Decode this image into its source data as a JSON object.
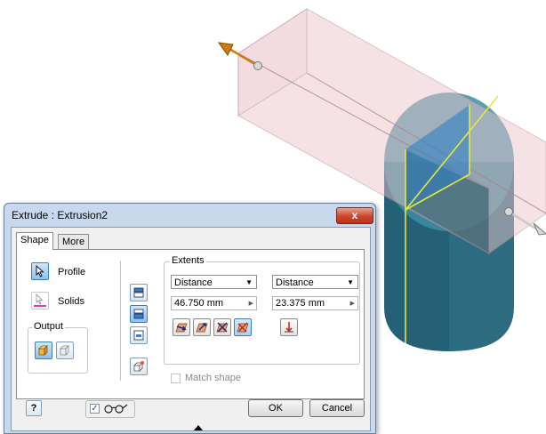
{
  "dialog": {
    "title": "Extrude : Extrusion2",
    "close_glyph": "x",
    "tabs": [
      {
        "label": "Shape",
        "active": true
      },
      {
        "label": "More",
        "active": false
      }
    ],
    "profile_label": "Profile",
    "solids_label": "Solids",
    "output_label": "Output",
    "extents": {
      "group_label": "Extents",
      "dropdown1_value": "Distance",
      "dropdown2_value": "Distance",
      "distance1": "46.750 mm",
      "distance2": "23.375 mm"
    },
    "match_shape_label": "Match shape",
    "help_glyph": "?",
    "ok_label": "OK",
    "cancel_label": "Cancel"
  },
  "icons": [
    "select-arrow-icon",
    "solid-body-icon",
    "glasses-preview-icon",
    "help-icon",
    "dropdown-arrow-icon"
  ],
  "colors": {
    "dialog_frame": "#c8d9ee",
    "close_red": "#c9462c",
    "extrusion_box": "#e9c4c9",
    "cylinder": "#2f6e82",
    "highlight_yellow": "#e8e838",
    "arrow_orange": "#d07a10"
  }
}
